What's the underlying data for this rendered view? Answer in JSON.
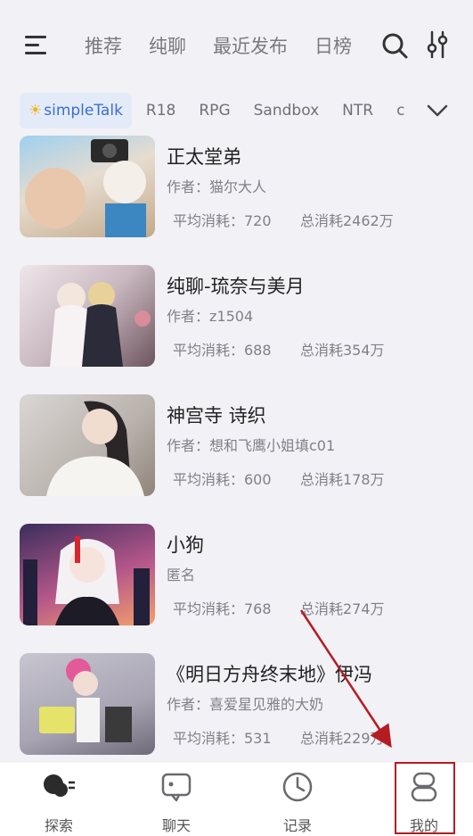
{
  "header": {
    "tabs": [
      "推荐",
      "纯聊",
      "最近发布",
      "日榜"
    ],
    "menu_icon": "hamburger-menu-icon",
    "search_icon": "search-icon",
    "filter_icon": "sliders-icon"
  },
  "chips": [
    "simpleTalk",
    "R18",
    "RPG",
    "Sandbox",
    "NTR",
    "c"
  ],
  "list": [
    {
      "title": "正太堂弟",
      "author": "作者：猫尔大人",
      "avg": "平均消耗：720",
      "total": "总消耗2462万"
    },
    {
      "title": "纯聊-琉奈与美月",
      "author": "作者：z1504",
      "avg": "平均消耗：688",
      "total": "总消耗354万"
    },
    {
      "title": "神宫寺 诗织",
      "author": "作者：想和飞鹰小姐填c01",
      "avg": "平均消耗：600",
      "total": "总消耗178万"
    },
    {
      "title": "小狗",
      "author": "匿名",
      "avg": "平均消耗：768",
      "total": "总消耗274万"
    },
    {
      "title": "《明日方舟终末地》伊冯",
      "author": "作者：喜爱星见雅的大奶",
      "avg": "平均消耗：531",
      "total": "总消耗229万"
    }
  ],
  "nav": [
    {
      "label": "探索",
      "icon": "explore-icon"
    },
    {
      "label": "聊天",
      "icon": "chat-icon"
    },
    {
      "label": "记录",
      "icon": "clock-icon"
    },
    {
      "label": "我的",
      "icon": "profile-icon"
    }
  ],
  "colors": {
    "accent": "#3a6fd0",
    "annotation": "#b51c22"
  }
}
